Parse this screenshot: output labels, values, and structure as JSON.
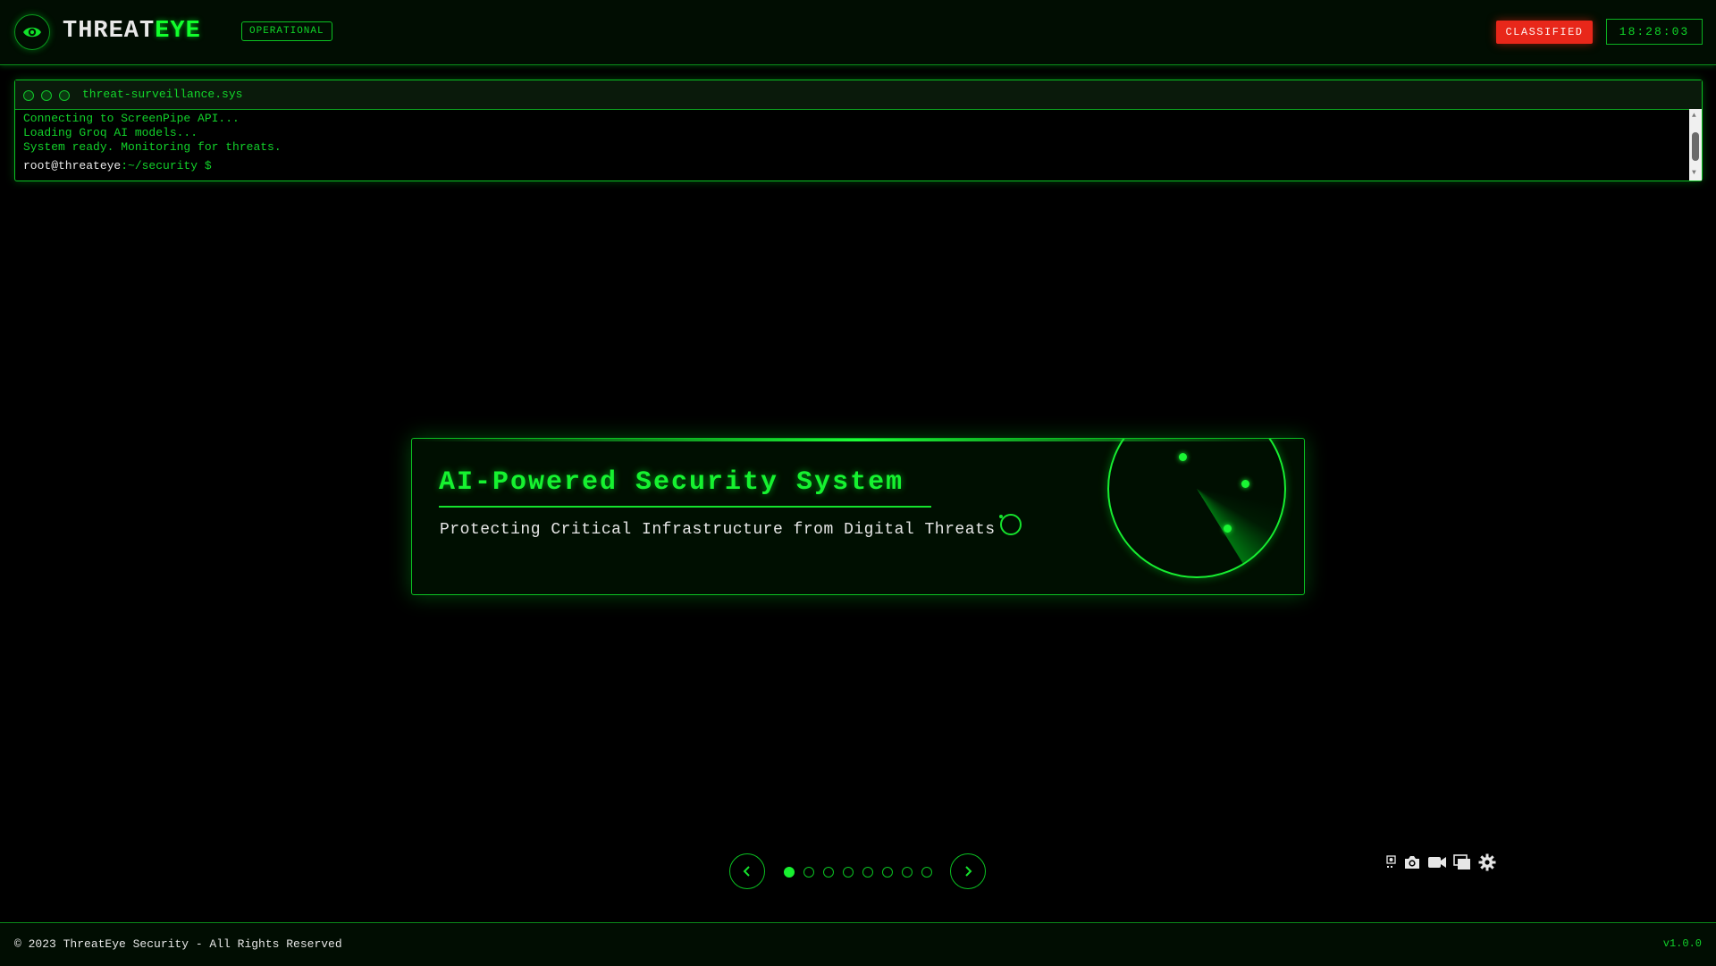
{
  "header": {
    "brand_part1": "THREAT",
    "brand_part2": "EYE",
    "status": "OPERATIONAL",
    "classification": "CLASSIFIED",
    "clock": "18:28:03"
  },
  "terminal": {
    "title": "threat-surveillance.sys",
    "lines": [
      "Connecting to ScreenPipe API...",
      "Loading Groq AI models...",
      "System ready. Monitoring for threats."
    ],
    "prompt_user": "root@threateye",
    "prompt_path": ":~/security $"
  },
  "hero": {
    "title": "AI-Powered Security System",
    "subtitle": "Protecting Critical Infrastructure from Digital Threats"
  },
  "carousel": {
    "slide_count": 8,
    "active_index": 0
  },
  "tray_icons": [
    "screenshot-icon",
    "camera-icon",
    "video-icon",
    "window-icon",
    "settings-icon"
  ],
  "footer": {
    "copyright": "© 2023 ThreatEye Security - All Rights Reserved",
    "version": "v1.0.0"
  },
  "colors": {
    "accent": "#00e21f",
    "background": "#000000",
    "alert": "#e8271a"
  }
}
